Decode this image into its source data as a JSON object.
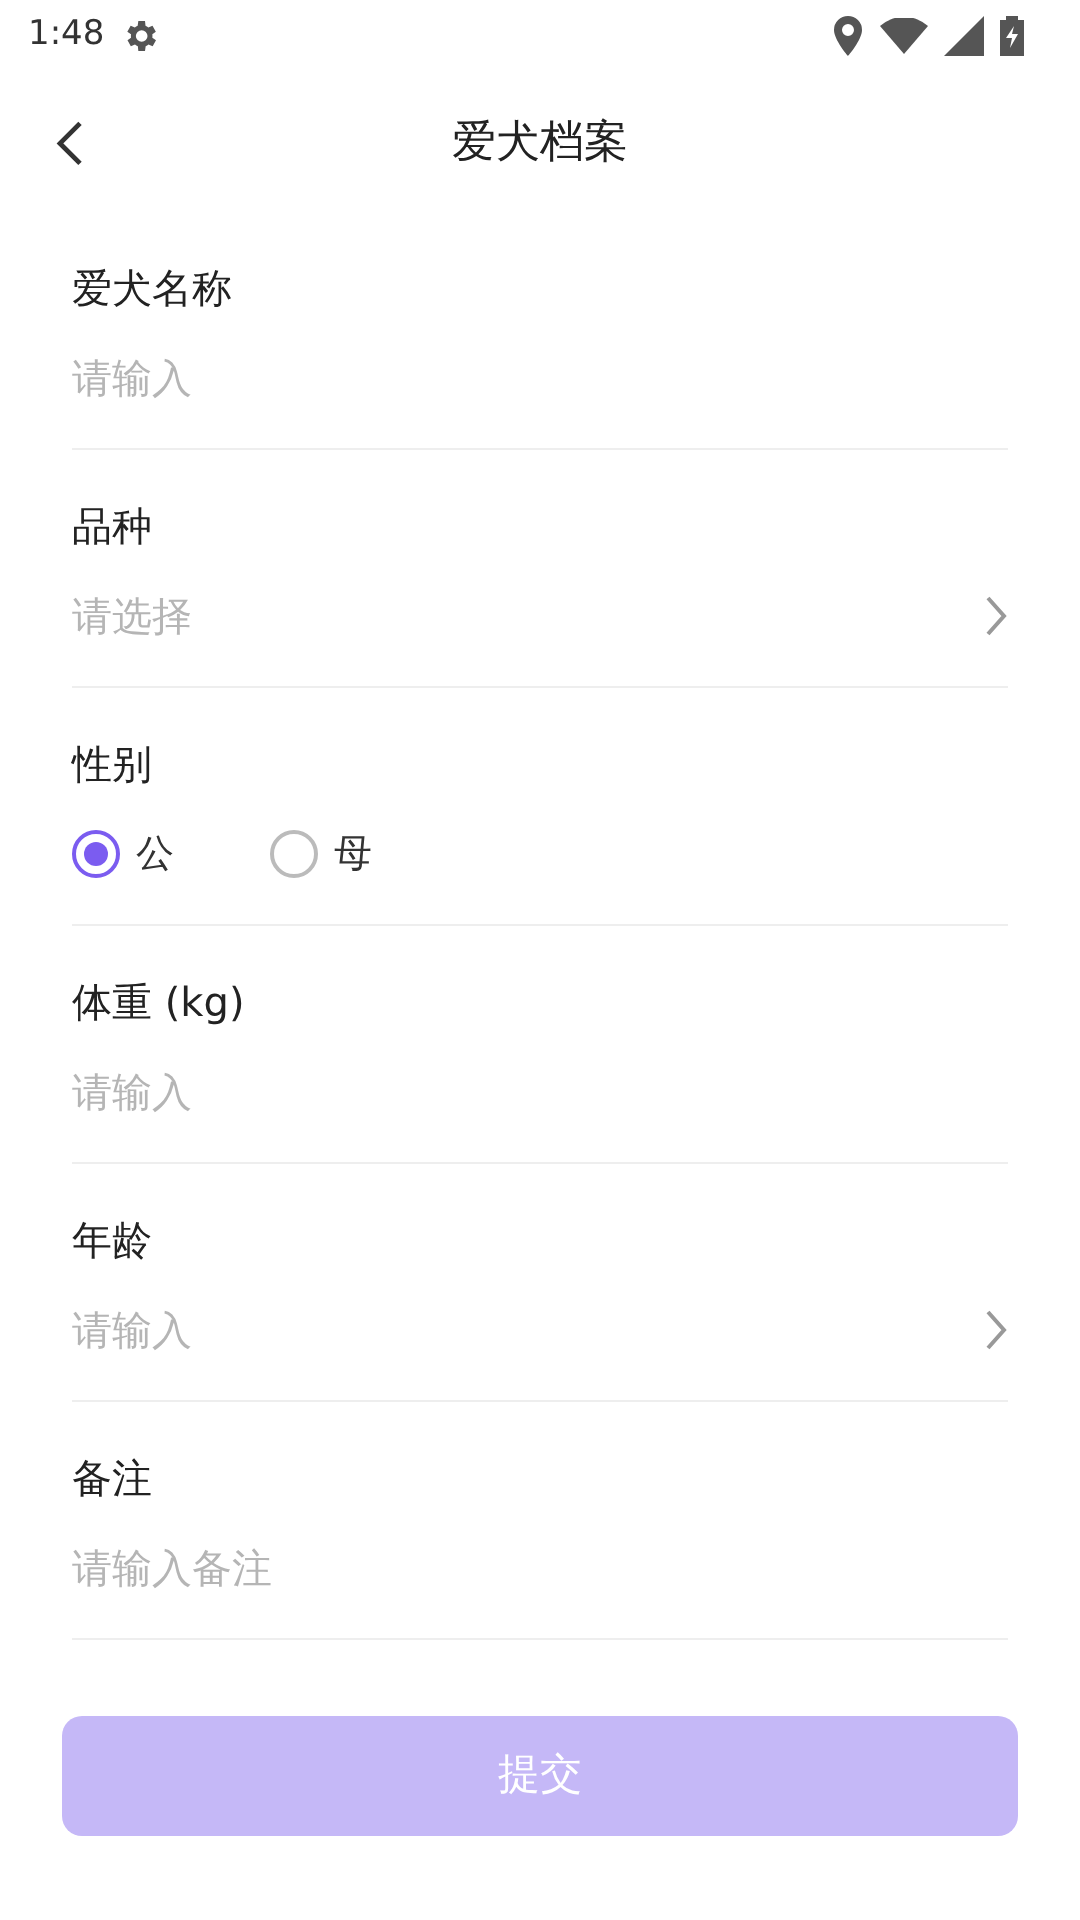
{
  "status_bar": {
    "time": "1:48"
  },
  "header": {
    "title": "爱犬档案"
  },
  "fields": [
    {
      "kind": "input",
      "label": "爱犬名称",
      "placeholder": "请输入"
    },
    {
      "kind": "select",
      "label": "品种",
      "placeholder": "请选择"
    },
    {
      "kind": "radio",
      "label": "性别",
      "options": [
        {
          "label": "公",
          "selected": true
        },
        {
          "label": "母",
          "selected": false
        }
      ]
    },
    {
      "kind": "input",
      "label": "体重 (kg)",
      "placeholder": "请输入"
    },
    {
      "kind": "select",
      "label": "年龄",
      "placeholder": "请输入"
    },
    {
      "kind": "input",
      "label": "备注",
      "placeholder": "请输入备注"
    }
  ],
  "submit": {
    "label": "提交",
    "disabled": true
  }
}
